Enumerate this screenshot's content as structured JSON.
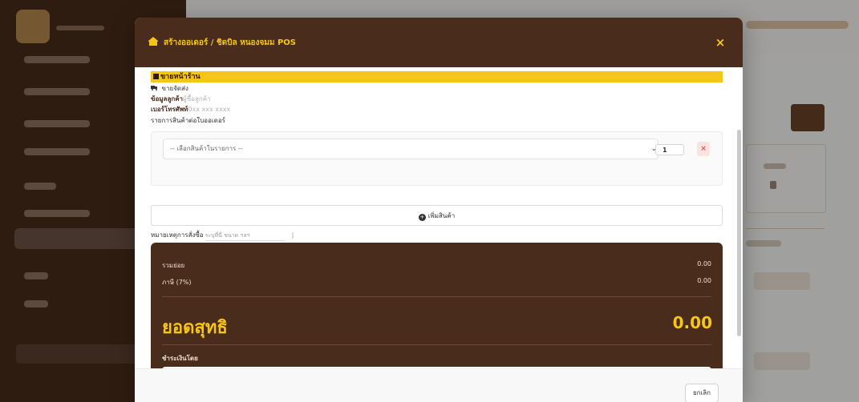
{
  "modal": {
    "title": "สร้างออเดอร์ / ชิดบิล หนองจมม POS",
    "close_label": "×",
    "mode_label": "ขายหน้าร้าน",
    "shipping_label": "ขายจัดส่ง",
    "customer_label": "ข้อมูลลูกค้า",
    "customer_placeholder": "ผู้ซื้อลูกค้า",
    "phone_label": "เบอร์โทรศัพท์",
    "phone_placeholder": "0xx xxx xxxx",
    "items_label": "รายการสินค้าต่อใบออเดอร์",
    "product_select_placeholder": "-- เลือกสินค้าในรายการ --",
    "quantity": "1",
    "remove_label": "×",
    "add_product_label": "เพิ่มสินค้า",
    "note_label": "หมายเหตุการสั่งซื้อ",
    "note_placeholder": "ระบุที่นี่ ขนาด ฯลฯ",
    "note_counter": "|",
    "summary": {
      "subtotal_label": "รวมย่อย",
      "subtotal_value": "0.00",
      "vat_label": "ภาษี (7%)",
      "vat_value": "0.00",
      "net_label": "ยอดสุทธิ",
      "net_value": "0.00",
      "payment_label": "ชำระเงินโดย"
    },
    "cancel_label": "ยกเลิก"
  },
  "colors": {
    "brand_brown": "#4a2c1c",
    "accent_yellow": "#f5c518",
    "danger_red": "#d9534f"
  },
  "icons": {
    "title": "store-icon",
    "shipping": "truck-icon",
    "add": "plus-circle-icon",
    "dropdown": "chevron-down-icon"
  }
}
